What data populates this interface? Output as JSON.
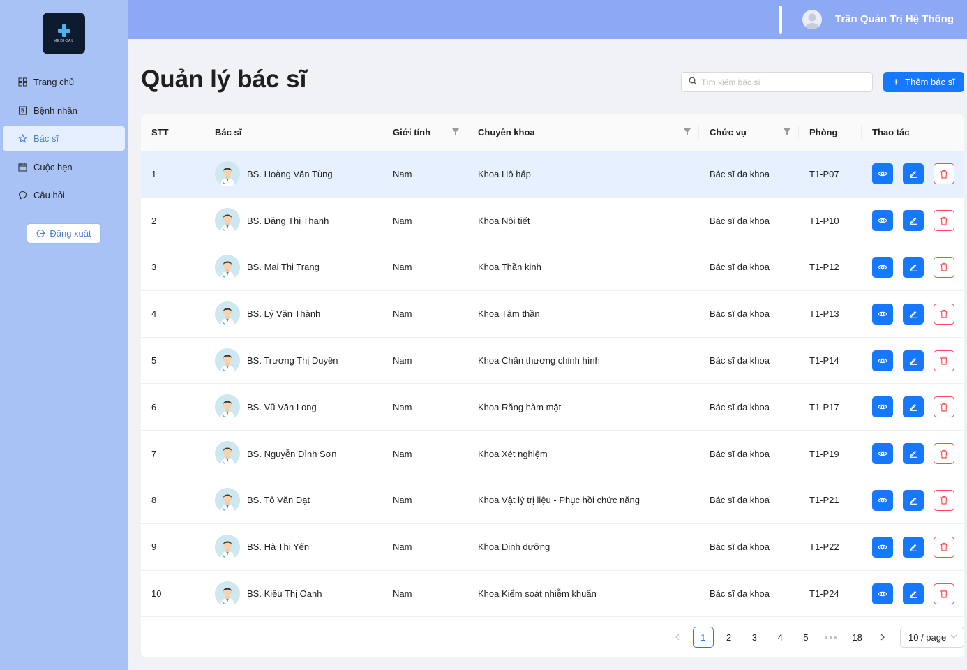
{
  "app": {
    "logo_text": "MEDICAL"
  },
  "header": {
    "user_name": "Trần Quản Trị Hệ Thống"
  },
  "sidebar": {
    "items": [
      {
        "label": "Trang chủ",
        "icon": "grid-icon"
      },
      {
        "label": "Bệnh nhân",
        "icon": "patient-icon"
      },
      {
        "label": "Bác sĩ",
        "icon": "star-icon",
        "active": true
      },
      {
        "label": "Cuộc hẹn",
        "icon": "calendar-icon"
      },
      {
        "label": "Câu hỏi",
        "icon": "chat-icon"
      }
    ],
    "logout_label": "Đăng xuất"
  },
  "main": {
    "title": "Quản lý bác sĩ",
    "search_placeholder": "Tìm kiếm bác sĩ",
    "add_button_label": "Thêm bác sĩ",
    "columns": [
      "STT",
      "Bác sĩ",
      "Giới tính",
      "Chuyên khoa",
      "Chức vụ",
      "Phòng",
      "Thao tác"
    ],
    "rows": [
      {
        "stt": "1",
        "name": "BS. Hoàng Văn Tùng",
        "gender": "Nam",
        "specialty": "Khoa Hô hấp",
        "position": "Bác sĩ đa khoa",
        "room": "T1-P07"
      },
      {
        "stt": "2",
        "name": "BS. Đặng Thị Thanh",
        "gender": "Nam",
        "specialty": "Khoa Nội tiết",
        "position": "Bác sĩ đa khoa",
        "room": "T1-P10"
      },
      {
        "stt": "3",
        "name": "BS. Mai Thị Trang",
        "gender": "Nam",
        "specialty": "Khoa Thần kinh",
        "position": "Bác sĩ đa khoa",
        "room": "T1-P12"
      },
      {
        "stt": "4",
        "name": "BS. Lý Văn Thành",
        "gender": "Nam",
        "specialty": "Khoa Tâm thần",
        "position": "Bác sĩ đa khoa",
        "room": "T1-P13"
      },
      {
        "stt": "5",
        "name": "BS. Trương Thị Duyên",
        "gender": "Nam",
        "specialty": "Khoa Chấn thương chỉnh hình",
        "position": "Bác sĩ đa khoa",
        "room": "T1-P14"
      },
      {
        "stt": "6",
        "name": "BS. Vũ Văn Long",
        "gender": "Nam",
        "specialty": "Khoa Răng hàm mặt",
        "position": "Bác sĩ đa khoa",
        "room": "T1-P17"
      },
      {
        "stt": "7",
        "name": "BS. Nguyễn Đình Sơn",
        "gender": "Nam",
        "specialty": "Khoa Xét nghiệm",
        "position": "Bác sĩ đa khoa",
        "room": "T1-P19"
      },
      {
        "stt": "8",
        "name": "BS. Tô Văn Đạt",
        "gender": "Nam",
        "specialty": "Khoa Vật lý trị liệu - Phục hồi chức năng",
        "position": "Bác sĩ đa khoa",
        "room": "T1-P21"
      },
      {
        "stt": "9",
        "name": "BS. Hà Thị Yến",
        "gender": "Nam",
        "specialty": "Khoa Dinh dưỡng",
        "position": "Bác sĩ đa khoa",
        "room": "T1-P22"
      },
      {
        "stt": "10",
        "name": "BS. Kiều Thị Oanh",
        "gender": "Nam",
        "specialty": "Khoa Kiểm soát nhiễm khuẩn",
        "position": "Bác sĩ đa khoa",
        "room": "T1-P24"
      }
    ],
    "pagination": {
      "pages": [
        "1",
        "2",
        "3",
        "4",
        "5"
      ],
      "current": "1",
      "ellipsis": "•••",
      "last": "18",
      "page_size": "10 / page"
    }
  },
  "colors": {
    "sidebar_bg": "#a9c2f6",
    "header_bg": "#8ea9f4",
    "primary": "#1677ff",
    "danger": "#ff4d4f"
  }
}
